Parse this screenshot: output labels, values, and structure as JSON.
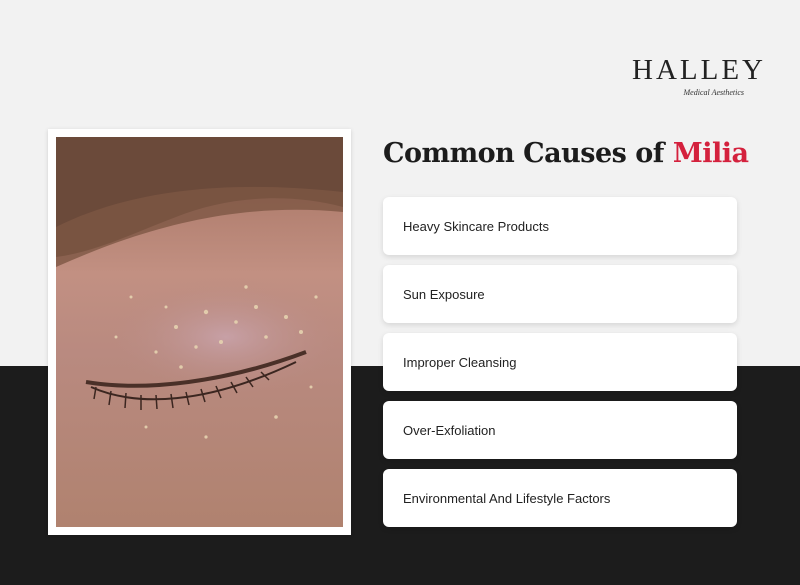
{
  "brand": {
    "logo_text": "HALLEY",
    "logo_sub": "Medical Aesthetics"
  },
  "heading": {
    "prefix": "Common Causes of",
    "highlight": "Milia"
  },
  "causes": [
    "Heavy Skincare Products",
    "Sun Exposure",
    "Improper Cleansing",
    "Over-Exfoliation",
    "Environmental And Lifestyle Factors"
  ],
  "colors": {
    "accent": "#d4213d",
    "dark_band": "#1c1c1c",
    "light_band": "#f2f2f2"
  },
  "image": {
    "subject": "close-up photo of a closed eye with milia on the eyelid"
  }
}
